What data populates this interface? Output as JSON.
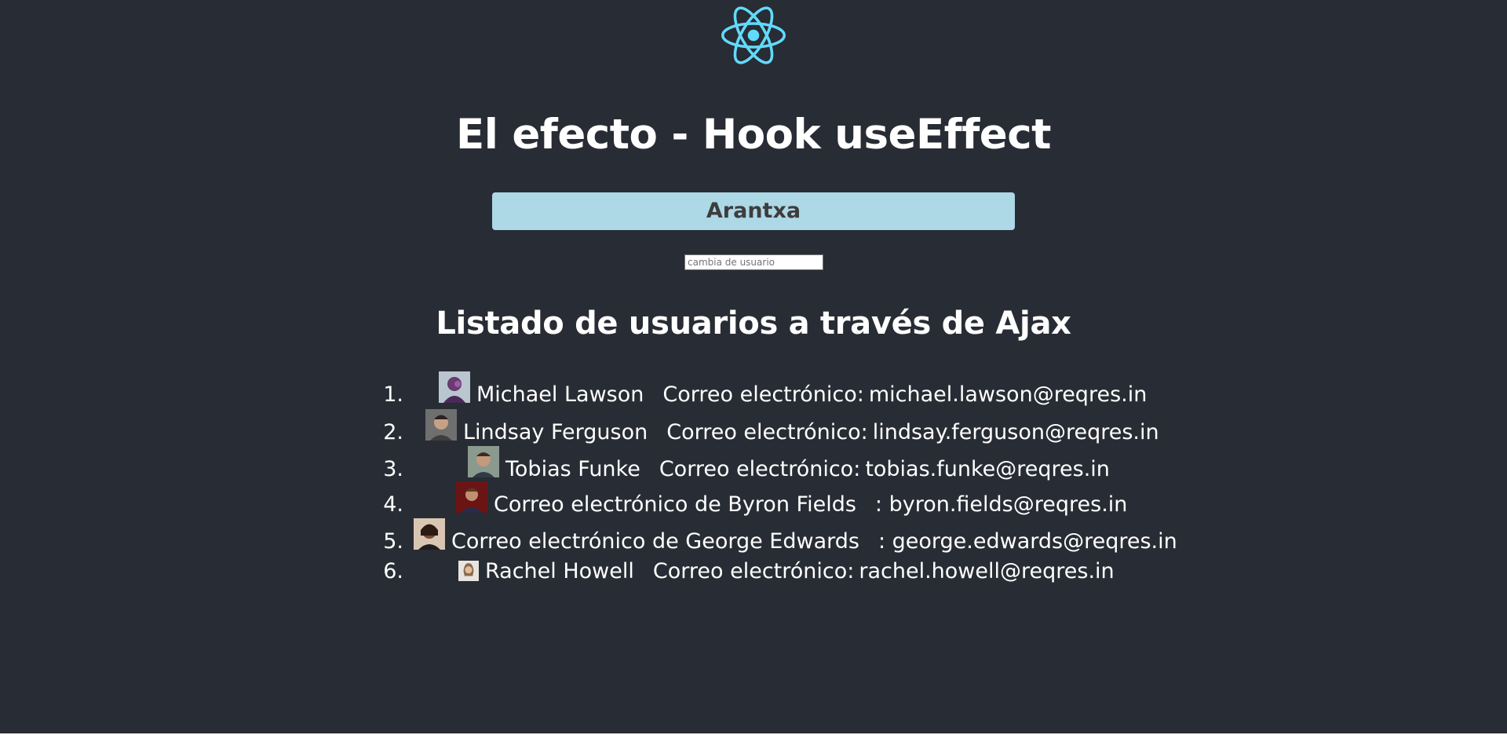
{
  "header": {
    "logo_icon": "react-logo-icon",
    "logo_color": "#61dafb",
    "title": "El efecto - Hook useEffect"
  },
  "current_user": {
    "name": "Arantxa",
    "banner_color": "#add8e6"
  },
  "user_input": {
    "value": "",
    "placeholder": "cambia de usuario"
  },
  "users_section": {
    "title": "Listado de usuarios a través de Ajax",
    "items": [
      {
        "number": "1.",
        "name": "Michael Lawson",
        "label": "Correo electrónico:",
        "email": "michael.lawson@reqres.in",
        "avatar_icon": "avatar-michael-lawson"
      },
      {
        "number": "2.",
        "name": "Lindsay Ferguson",
        "label": "Correo electrónico:",
        "email": "lindsay.ferguson@reqres.in",
        "avatar_icon": "avatar-lindsay-ferguson"
      },
      {
        "number": "3.",
        "name": "Tobias Funke",
        "label": "Correo electrónico:",
        "email": "tobias.funke@reqres.in",
        "avatar_icon": "avatar-tobias-funke"
      },
      {
        "number": "4.",
        "text": "Correo electrónico de Byron Fields",
        "email": ": byron.fields@reqres.in",
        "avatar_icon": "avatar-byron-fields"
      },
      {
        "number": "5.",
        "text": "Correo electrónico de George Edwards",
        "email": ": george.edwards@reqres.in",
        "avatar_icon": "avatar-george-edwards"
      },
      {
        "number": "6.",
        "name": "Rachel Howell",
        "label": "Correo electrónico:",
        "email": "rachel.howell@reqres.in",
        "avatar_icon": "avatar-rachel-howell"
      }
    ]
  },
  "colors": {
    "background": "#282c34",
    "text": "#ffffff"
  }
}
